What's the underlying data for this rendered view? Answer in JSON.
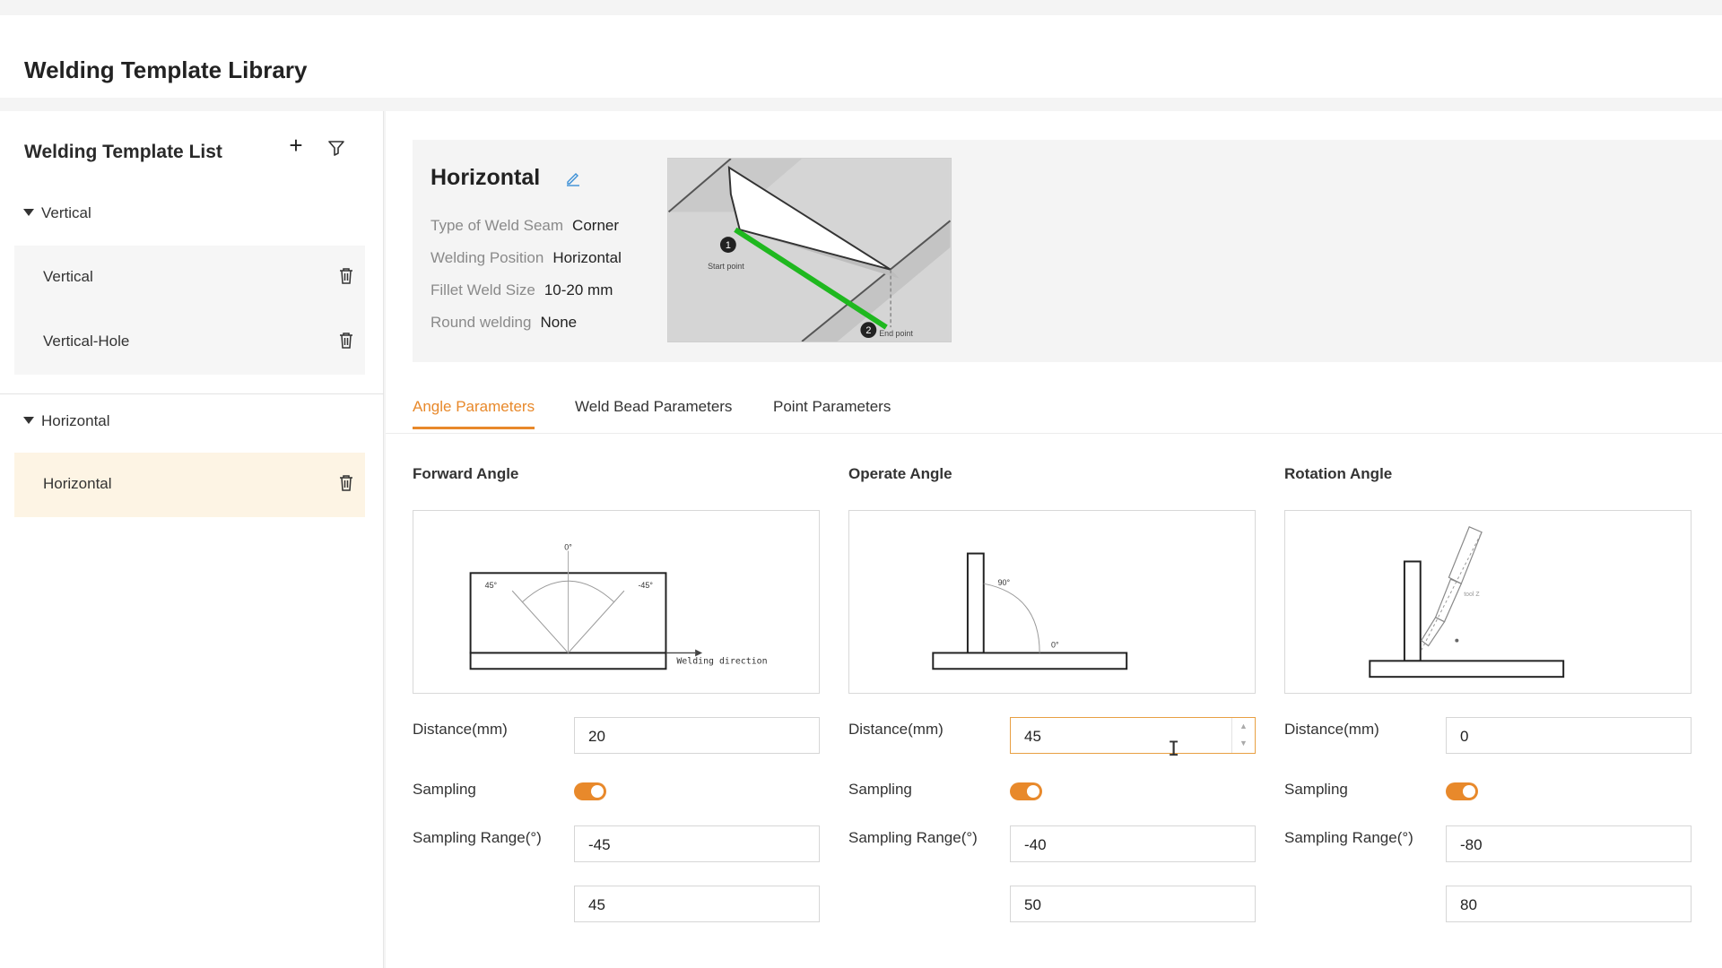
{
  "app": {
    "title": "Welding Template Library"
  },
  "sidebar": {
    "title": "Welding Template List",
    "groups": [
      {
        "label": "Vertical",
        "items": [
          {
            "label": "Vertical"
          },
          {
            "label": "Vertical-Hole"
          }
        ]
      },
      {
        "label": "Horizontal",
        "items": [
          {
            "label": "Horizontal",
            "active": true
          }
        ]
      }
    ]
  },
  "template": {
    "name": "Horizontal",
    "info": [
      {
        "key": "Type of Weld Seam",
        "value": "Corner"
      },
      {
        "key": "Welding Position",
        "value": "Horizontal"
      },
      {
        "key": "Fillet Weld Size",
        "value": "10-20 mm"
      },
      {
        "key": "Round welding",
        "value": "None"
      }
    ],
    "preview": {
      "start_label": "Start point",
      "end_label": "End point",
      "marker_1": "1",
      "marker_2": "2"
    }
  },
  "tabs": [
    {
      "label": "Angle Parameters",
      "active": true
    },
    {
      "label": "Weld Bead Parameters"
    },
    {
      "label": "Point Parameters"
    }
  ],
  "angles": [
    {
      "title": "Forward Angle",
      "diagram": {
        "zero": "0°",
        "left": "45°",
        "right": "-45°",
        "direction": "Welding direction"
      },
      "distance_label": "Distance(mm)",
      "distance": "20",
      "sampling_label": "Sampling",
      "sampling": true,
      "range_label": "Sampling Range(°)",
      "range_min": "-45",
      "range_max": "45"
    },
    {
      "title": "Operate Angle",
      "diagram": {
        "top": "90°",
        "bottom": "0°"
      },
      "distance_label": "Distance(mm)",
      "distance": "45",
      "sampling_label": "Sampling",
      "sampling": true,
      "range_label": "Sampling Range(°)",
      "range_min": "-40",
      "range_max": "50"
    },
    {
      "title": "Rotation Angle",
      "diagram": {
        "tool": "tool Z"
      },
      "distance_label": "Distance(mm)",
      "distance": "0",
      "sampling_label": "Sampling",
      "sampling": true,
      "range_label": "Sampling Range(°)",
      "range_min": "-80",
      "range_max": "80"
    }
  ],
  "colors": {
    "accent": "#e8892b",
    "active_item_bg": "#fdf4e4",
    "weld_line": "#1fb81f"
  }
}
